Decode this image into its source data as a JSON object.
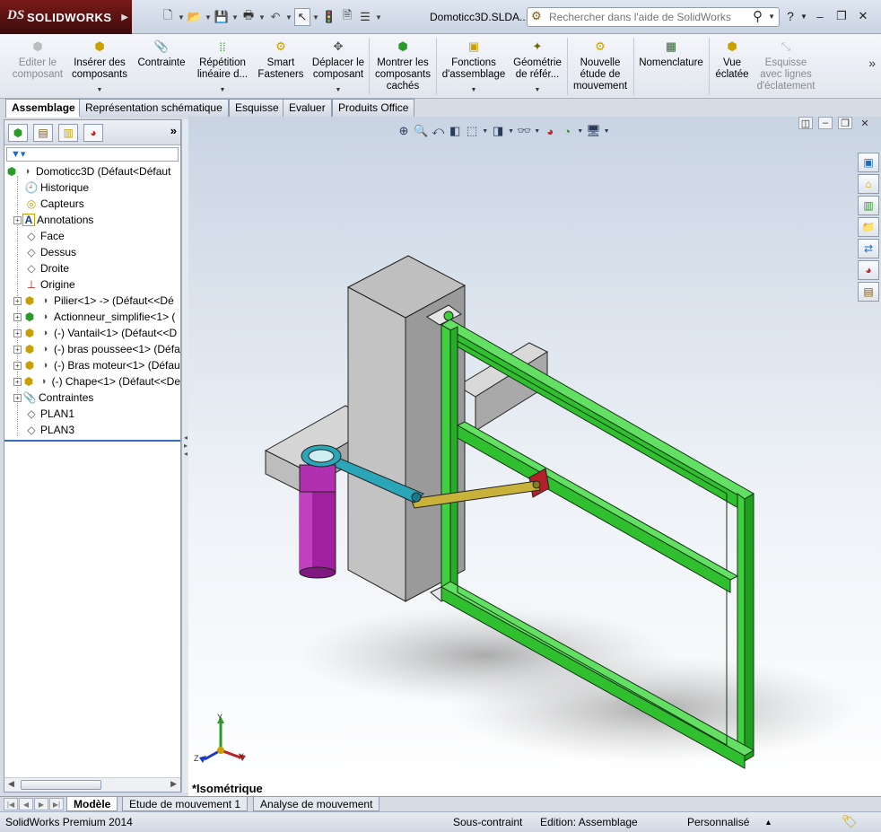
{
  "app": {
    "brand": "SOLIDWORKS",
    "brand_prefix": "DS",
    "document_title": "Domoticc3D.SLDA..."
  },
  "search": {
    "placeholder": "Rechercher dans l'aide de SolidWorks"
  },
  "command_manager": {
    "items": [
      {
        "label": "Editer le\ncomposant",
        "enabled": false
      },
      {
        "label": "Insérer des\ncomposants",
        "enabled": true
      },
      {
        "label": "Contrainte",
        "enabled": true
      },
      {
        "label": "Répétition\nlinéaire d...",
        "enabled": true
      },
      {
        "label": "Smart\nFasteners",
        "enabled": true
      },
      {
        "label": "Déplacer le\ncomposant",
        "enabled": true
      },
      {
        "label": "Montrer les\ncomposants\ncachés",
        "enabled": true
      },
      {
        "label": "Fonctions\nd'assemblage",
        "enabled": true
      },
      {
        "label": "Géométrie\nde référ...",
        "enabled": true
      },
      {
        "label": "Nouvelle\nétude de\nmouvement",
        "enabled": true
      },
      {
        "label": "Nomenclature",
        "enabled": true
      },
      {
        "label": "Vue\néclatée",
        "enabled": true
      },
      {
        "label": "Esquisse\navec lignes\nd'éclatement",
        "enabled": false
      }
    ]
  },
  "tabs": [
    "Assemblage",
    "Représentation schématique",
    "Esquisse",
    "Evaluer",
    "Produits Office"
  ],
  "active_tab": "Assemblage",
  "feature_tree": {
    "root": "Domoticc3D  (Défaut<Défaut",
    "items": [
      {
        "label": "Historique",
        "type": "history"
      },
      {
        "label": "Capteurs",
        "type": "sensor"
      },
      {
        "label": "Annotations",
        "type": "annotation",
        "expandable": true
      },
      {
        "label": "Face",
        "type": "plane"
      },
      {
        "label": "Dessus",
        "type": "plane"
      },
      {
        "label": "Droite",
        "type": "plane"
      },
      {
        "label": "Origine",
        "type": "origin"
      },
      {
        "label": "Pilier<1> -> (Défaut<<Dé",
        "type": "part",
        "expandable": true
      },
      {
        "label": "Actionneur_simplifie<1> (",
        "type": "part",
        "expandable": true
      },
      {
        "label": "(-) Vantail<1> (Défaut<<D",
        "type": "part",
        "expandable": true
      },
      {
        "label": "(-) bras poussee<1> (Défa",
        "type": "part",
        "expandable": true
      },
      {
        "label": "(-) Bras moteur<1> (Défau",
        "type": "part",
        "expandable": true
      },
      {
        "label": "(-) Chape<1> (Défaut<<De",
        "type": "part",
        "expandable": true
      },
      {
        "label": "Contraintes",
        "type": "mates",
        "expandable": true
      },
      {
        "label": "PLAN1",
        "type": "plane"
      },
      {
        "label": "PLAN3",
        "type": "plane"
      }
    ]
  },
  "viewport": {
    "view_name": "*Isométrique",
    "triad": {
      "x": "X",
      "y": "Y",
      "z": "Z"
    },
    "colors": {
      "frame": "#3fcf3f",
      "pillar": "#bfbfbf",
      "actuator": "#a020a0",
      "arm_motor": "#2aa6b8",
      "arm_push": "#c9b23a",
      "clevis": "#b3202a"
    }
  },
  "bottom_tabs": [
    "Modèle",
    "Etude de mouvement 1",
    "Analyse de mouvement"
  ],
  "active_bottom_tab": "Modèle",
  "status": {
    "product": "SolidWorks Premium 2014",
    "constraint": "Sous-contraint",
    "edition": "Edition: Assemblage",
    "units": "Personnalisé"
  }
}
